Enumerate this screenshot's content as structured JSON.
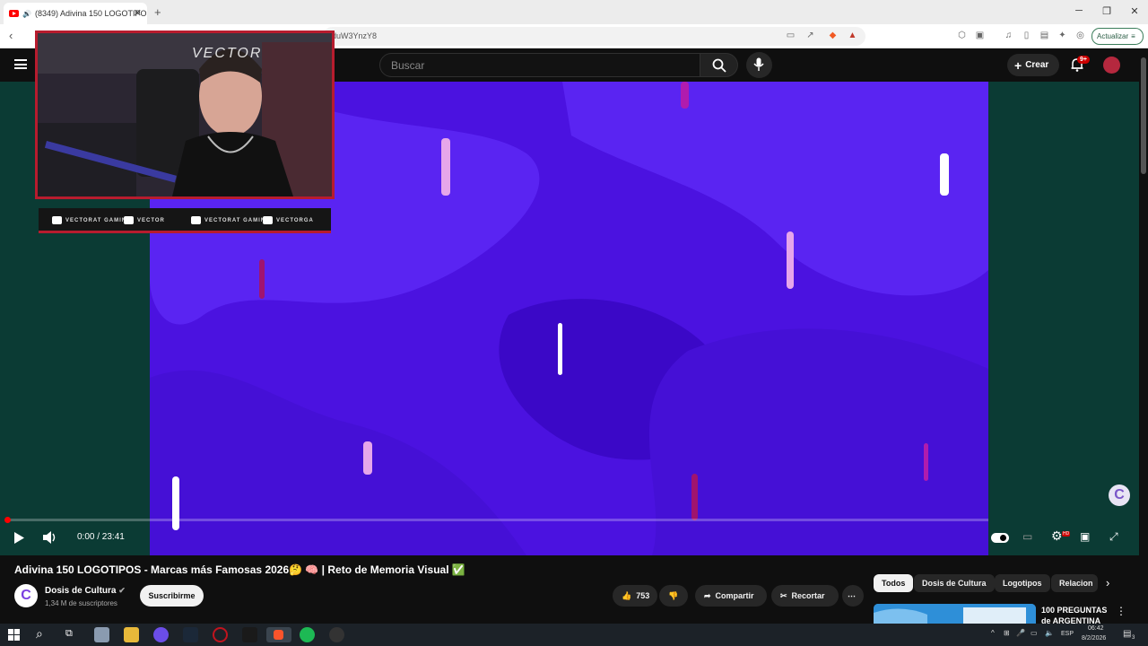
{
  "browser": {
    "tab_title": "(8349) Adivina 150 LOGOTIPO",
    "url_fragment": "duW3YnzY8",
    "update_label": "Actualizar"
  },
  "youtube_header": {
    "search_placeholder": "Buscar",
    "create_label": "Crear",
    "notifications_badge": "9+"
  },
  "overlay": {
    "streamer_watermark": "VECTOR",
    "socials": [
      {
        "platform": "youtube",
        "label": "VECTORAT GAMING"
      },
      {
        "platform": "twitch",
        "label": "VECTOR"
      },
      {
        "platform": "twitter",
        "label": "VECTORAT GAMING"
      },
      {
        "platform": "instagram",
        "label": "VECTORGA"
      }
    ]
  },
  "player": {
    "time": "0:00 / 23:41",
    "progress_fraction": 0.0,
    "hd_badge": "HD"
  },
  "video": {
    "title": "Adivina 150 LOGOTIPOS - Marcas más Famosas 2026🤔 🧠 | Reto de Memoria Visual ✅",
    "channel_name": "Dosis de Cultura",
    "subscribers": "1,34 M de suscriptores",
    "subscribe_label": "Suscribirme",
    "likes": "753",
    "share_label": "Compartir",
    "clip_label": "Recortar",
    "channel_initial": "C"
  },
  "chips": [
    {
      "label": "Todos",
      "active": true
    },
    {
      "label": "Dosis de Cultura",
      "active": false
    },
    {
      "label": "Logotipos",
      "active": false
    },
    {
      "label": "Relacion",
      "active": false
    }
  ],
  "recommendation": {
    "title_line1": "100 PREGUNTAS",
    "title_line2": "de ARGENTINA"
  },
  "taskbar": {
    "language": "ESP",
    "time": "06:42",
    "date": "8/2/2026",
    "notification_count": "3"
  },
  "colors": {
    "video_bg": "#4b12e0",
    "brand_red": "#ff0000",
    "overlay_border": "#b71c2e"
  }
}
